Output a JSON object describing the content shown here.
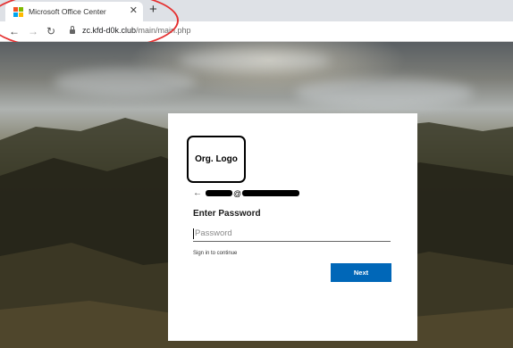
{
  "browser": {
    "tab": {
      "title": "Microsoft Office Center",
      "close_icon": "close-icon",
      "favicon": "microsoft-logo-icon"
    },
    "new_tab_icon": "plus-icon",
    "toolbar": {
      "back_icon": "back-arrow-icon",
      "forward_icon": "forward-arrow-icon",
      "reload_icon": "reload-icon",
      "lock_icon": "lock-icon",
      "url_host": "zc.kfd-d0k.club",
      "url_path": "/main/main.php"
    },
    "annotation_color": "#e53030"
  },
  "login": {
    "logo_text": "Org. Logo",
    "identity_at": "@",
    "heading": "Enter Password",
    "password_placeholder": "Password",
    "hint": "Sign in to continue",
    "next_label": "Next",
    "accent_color": "#0067b8"
  }
}
